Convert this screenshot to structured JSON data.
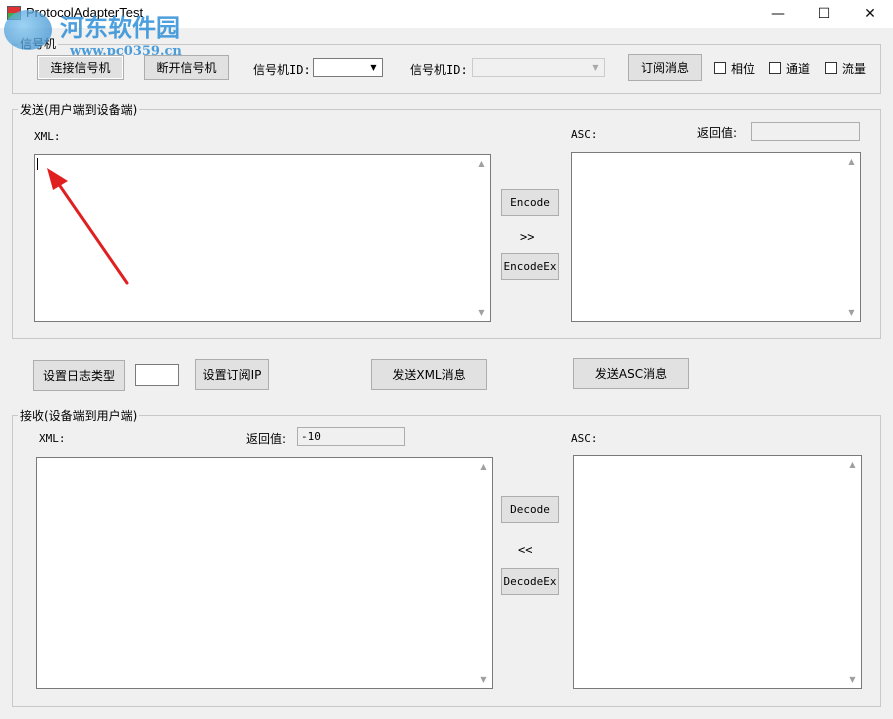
{
  "window": {
    "title": "ProtocolAdapterTest",
    "minimize": "—",
    "maximize": "☐",
    "close": "✕"
  },
  "watermark": {
    "name": "河东软件园",
    "url": "www.pc0359.cn"
  },
  "signal": {
    "group_label": "信号机",
    "connect": "连接信号机",
    "disconnect": "断开信号机",
    "id_label_1": "信号机ID:",
    "id_label_2": "信号机ID:",
    "subscribe": "订阅消息",
    "phase": "相位",
    "channel": "通道",
    "flow": "流量"
  },
  "send": {
    "group_label": "发送(用户端到设备端)",
    "xml_label": "XML:",
    "asc_label": "ASC:",
    "return_label": "返回值:",
    "return_value": "",
    "encode": "Encode",
    "encode_arrow": ">>",
    "encode_ex": "EncodeEx"
  },
  "middle": {
    "set_log_type": "设置日志类型",
    "log_value": "",
    "set_sub_ip": "设置订阅IP",
    "send_xml": "发送XML消息",
    "send_asc": "发送ASC消息"
  },
  "receive": {
    "group_label": "接收(设备端到用户端)",
    "xml_label": "XML:",
    "return_label": "返回值:",
    "return_value": "-10",
    "asc_label": "ASC:",
    "decode": "Decode",
    "decode_arrow": "<<",
    "decode_ex": "DecodeEx"
  },
  "colors": {
    "annotation_arrow": "#e02020",
    "watermark": "#2e8fd8"
  }
}
